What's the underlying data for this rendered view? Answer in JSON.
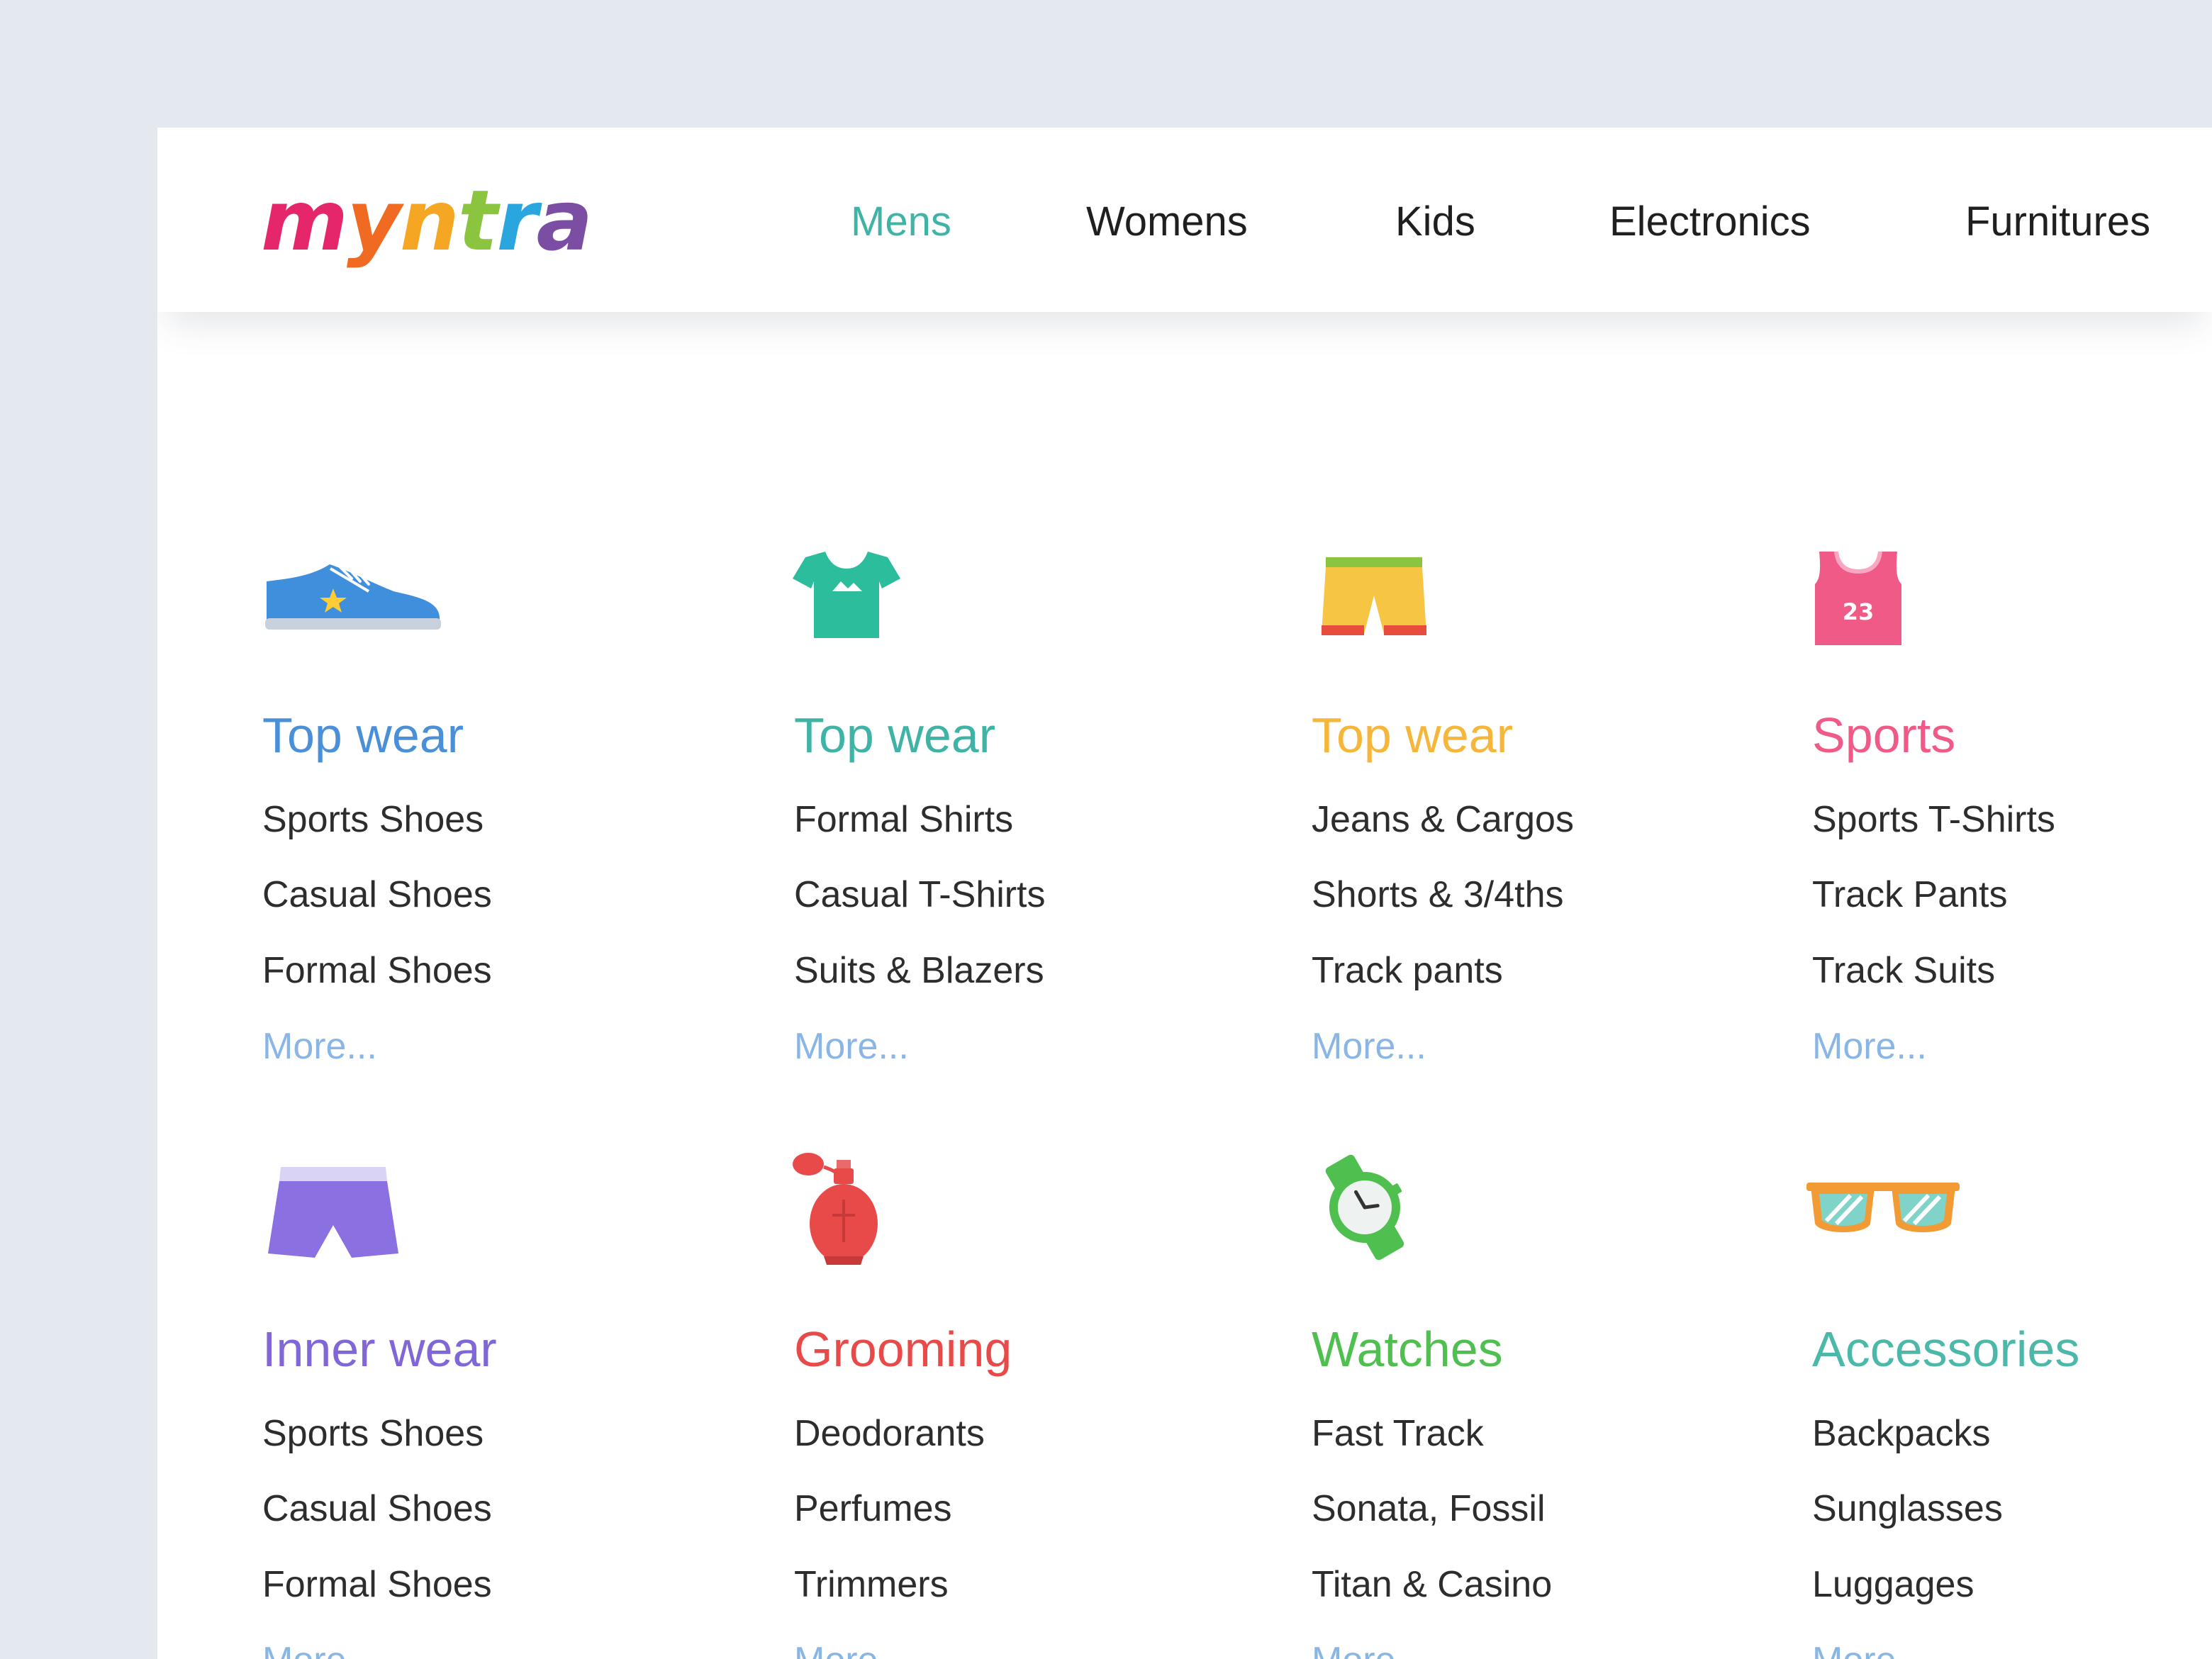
{
  "brand": {
    "logo_text": "myntra",
    "logo_colors": [
      "#e5266a",
      "#f06a22",
      "#f5a623",
      "#8bc53f",
      "#2aa6df",
      "#7b4ea3"
    ]
  },
  "nav": {
    "items": [
      {
        "label": "Mens",
        "active": true
      },
      {
        "label": "Womens",
        "active": false
      },
      {
        "label": "Kids",
        "active": false
      },
      {
        "label": "Electronics",
        "active": false
      },
      {
        "label": "Furnitures",
        "active": false
      }
    ],
    "active_color": "#3fb3a5"
  },
  "categories": [
    {
      "icon": "sneaker-icon",
      "title": "Top wear",
      "color": "#4a90d9",
      "items": [
        "Sports Shoes",
        "Casual Shoes",
        "Formal Shoes"
      ],
      "more": "More..."
    },
    {
      "icon": "tshirt-icon",
      "title": "Top wear",
      "color": "#3fb3a5",
      "items": [
        "Formal Shirts",
        "Casual T-Shirts",
        "Suits & Blazers"
      ],
      "more": "More..."
    },
    {
      "icon": "shorts-icon",
      "title": "Top wear",
      "color": "#f5b63a",
      "items": [
        "Jeans & Cargos",
        "Shorts & 3/4ths",
        "Track pants"
      ],
      "more": "More..."
    },
    {
      "icon": "jersey-icon",
      "title": "Sports",
      "color": "#ef5a87",
      "items": [
        "Sports T-Shirts",
        "Track Pants",
        "Track Suits"
      ],
      "more": "More...",
      "jersey_number": "23"
    },
    {
      "icon": "briefs-icon",
      "title": "Inner wear",
      "color": "#8066d6",
      "items": [
        "Sports Shoes",
        "Casual Shoes",
        "Formal Shoes"
      ],
      "more": "More..."
    },
    {
      "icon": "perfume-icon",
      "title": "Grooming",
      "color": "#e84a4a",
      "items": [
        "Deodorants",
        "Perfumes",
        "Trimmers"
      ],
      "more": "More..."
    },
    {
      "icon": "watch-icon",
      "title": "Watches",
      "color": "#4fc04f",
      "items": [
        "Fast Track",
        "Sonata, Fossil",
        "Titan & Casino"
      ],
      "more": "More..."
    },
    {
      "icon": "sunglasses-icon",
      "title": "Accessories",
      "color": "#4bb8aa",
      "items": [
        "Backpacks",
        "Sunglasses",
        "Luggages"
      ],
      "more": "More..."
    }
  ]
}
